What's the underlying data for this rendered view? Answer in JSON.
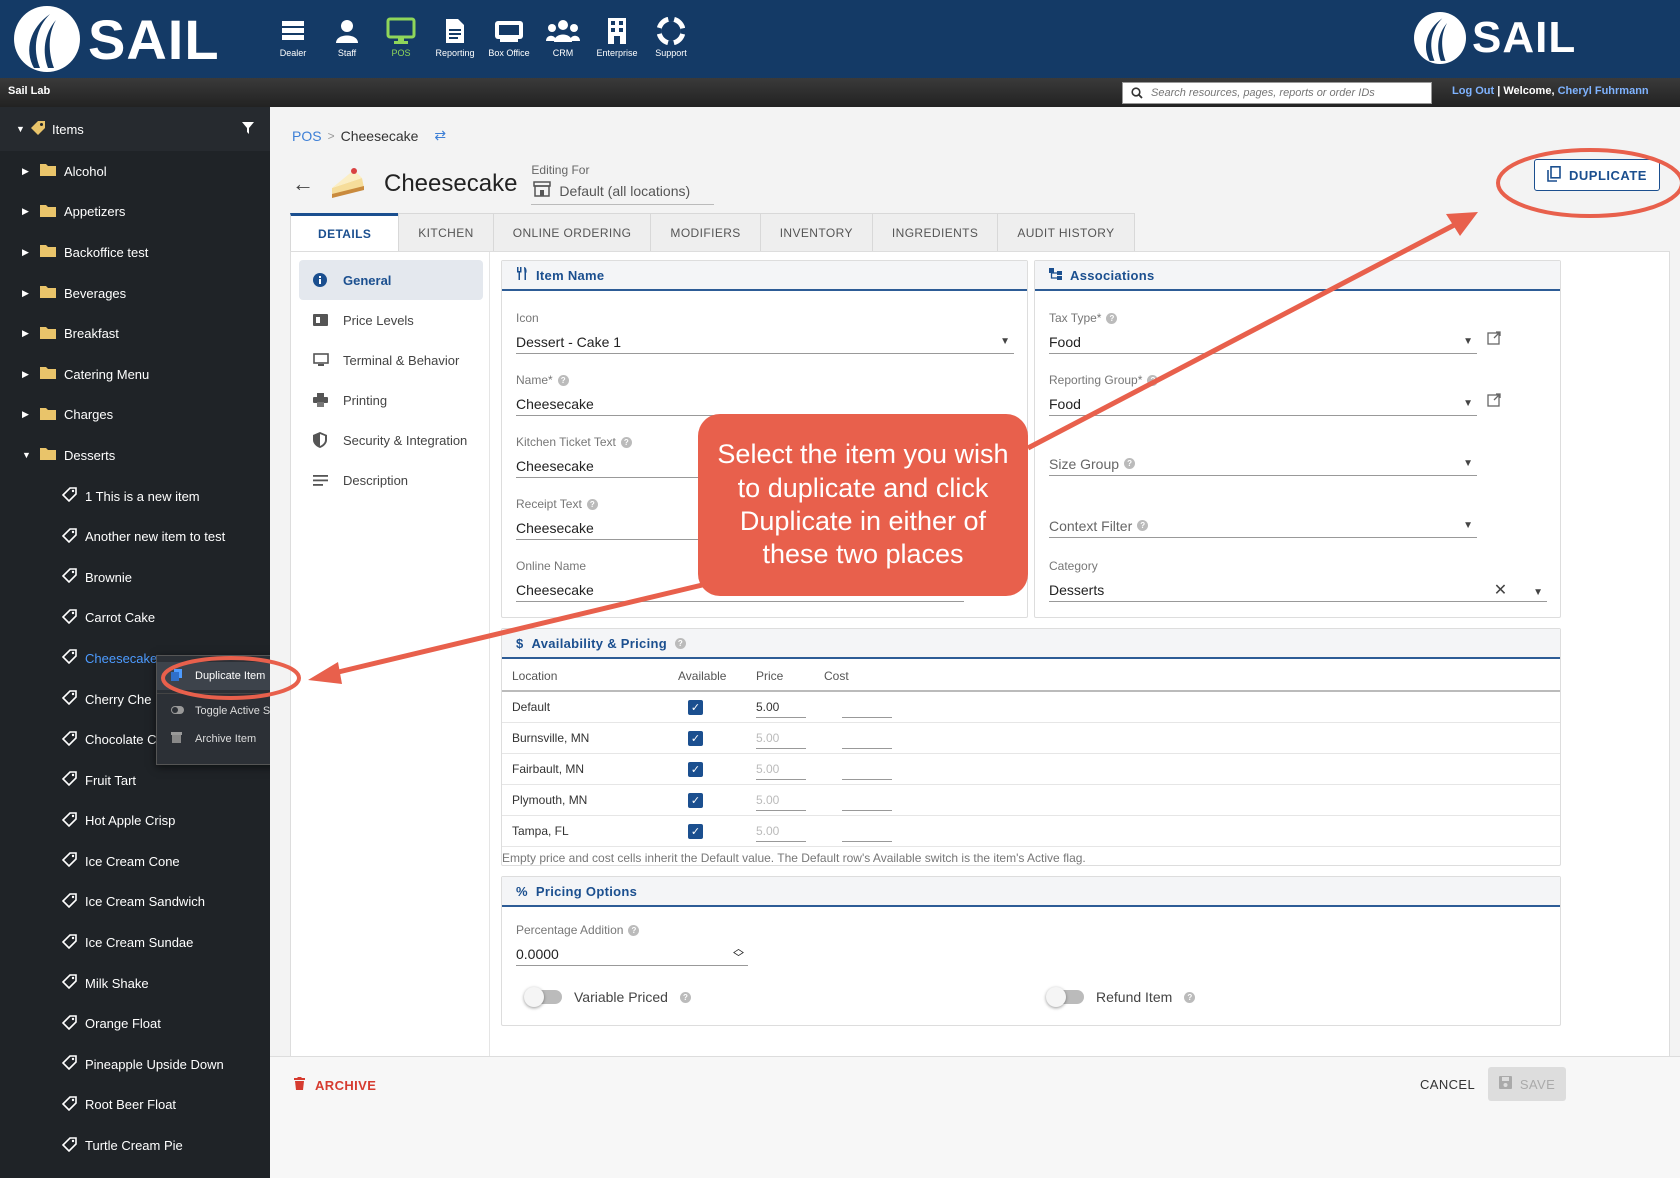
{
  "header": {
    "brand": "SAIL",
    "nav": [
      {
        "label": "Dealer",
        "icon": "dealer-icon"
      },
      {
        "label": "Staff",
        "icon": "staff-icon"
      },
      {
        "label": "POS",
        "icon": "pos-monitor-icon",
        "active": true
      },
      {
        "label": "Reporting",
        "icon": "reporting-icon"
      },
      {
        "label": "Box Office",
        "icon": "box-office-icon"
      },
      {
        "label": "CRM",
        "icon": "crm-icon"
      },
      {
        "label": "Enterprise",
        "icon": "enterprise-icon"
      },
      {
        "label": "Support",
        "icon": "support-icon"
      }
    ]
  },
  "subbar": {
    "org": "Sail Lab",
    "search_placeholder": "Search resources, pages, reports or order IDs",
    "logout": "Log Out",
    "welcome": "Welcome,",
    "user": "Cheryl Fuhrmann"
  },
  "sidebar": {
    "title": "Items",
    "folders_top": [
      "Alcohol",
      "Appetizers",
      "Backoffice test",
      "Beverages",
      "Breakfast",
      "Catering Menu",
      "Charges"
    ],
    "open_folder": "Desserts",
    "items": [
      "1 This is a new item",
      "Another new item to test",
      "Brownie",
      "Carrot Cake",
      "Cheesecake",
      "Cherry Cheesecake",
      "Chocolate Cake",
      "Fruit Tart",
      "Hot Apple Crisp",
      "Ice Cream Cone",
      "Ice Cream Sandwich",
      "Ice Cream Sundae",
      "Milk Shake",
      "Orange Float",
      "Pineapple Upside Down",
      "Root Beer Float",
      "Turtle Cream Pie"
    ],
    "items_visible": [
      "1 This is a new item",
      "Another new item to test",
      "Brownie",
      "Carrot Cake",
      "Cheesecake",
      "Cherry Che",
      "Chocolate C",
      "Fruit Tart",
      "Hot Apple Crisp",
      "Ice Cream Cone",
      "Ice Cream Sandwich",
      "Ice Cream Sundae",
      "Milk Shake",
      "Orange Float",
      "Pineapple Upside Down",
      "Root Beer Float",
      "Turtle Cream Pie"
    ],
    "selected_item": "Cheesecake"
  },
  "context_menu": {
    "items": [
      "Duplicate Item",
      "Toggle Active State",
      "Archive Item"
    ]
  },
  "breadcrumb": {
    "root": "POS",
    "sep": ">",
    "current": "Cheesecake"
  },
  "page": {
    "title": "Cheesecake",
    "editing_for_label": "Editing For",
    "editing_for_value": "Default (all locations)",
    "duplicate_label": "DUPLICATE"
  },
  "tabs": [
    "DETAILS",
    "KITCHEN",
    "ONLINE ORDERING",
    "MODIFIERS",
    "INVENTORY",
    "INGREDIENTS",
    "AUDIT HISTORY"
  ],
  "subnav": [
    "General",
    "Price Levels",
    "Terminal & Behavior",
    "Printing",
    "Security & Integration",
    "Description"
  ],
  "item_name": {
    "title": "Item Name",
    "icon_label": "Icon",
    "icon_value": "Dessert - Cake 1",
    "name_label": "Name*",
    "name_value": "Cheesecake",
    "kitchen_label": "Kitchen Ticket Text",
    "kitchen_value": "Cheesecake",
    "receipt_label": "Receipt Text",
    "receipt_value": "Cheesecake",
    "online_label": "Online Name",
    "online_value": "Cheesecake"
  },
  "associations": {
    "title": "Associations",
    "tax_label": "Tax Type*",
    "tax_value": "Food",
    "reporting_label": "Reporting Group*",
    "reporting_value": "Food",
    "size_label": "Size Group",
    "context_label": "Context Filter",
    "category_label": "Category",
    "category_value": "Desserts"
  },
  "availability": {
    "title": "Availability & Pricing",
    "columns": [
      "Location",
      "Available",
      "Price",
      "Cost"
    ],
    "rows": [
      {
        "location": "Default",
        "available": true,
        "price": "5.00",
        "cost": ""
      },
      {
        "location": "Burnsville, MN",
        "available": true,
        "price": "5.00",
        "cost": ""
      },
      {
        "location": "Fairbault, MN",
        "available": true,
        "price": "5.00",
        "cost": ""
      },
      {
        "location": "Plymouth, MN",
        "available": true,
        "price": "5.00",
        "cost": ""
      },
      {
        "location": "Tampa, FL",
        "available": true,
        "price": "5.00",
        "cost": ""
      }
    ],
    "note": "Empty price and cost cells inherit the Default value. The Default row's Available switch is the item's Active flag."
  },
  "pricing_options": {
    "title": "Pricing Options",
    "pct_label": "Percentage Addition",
    "pct_value": "0.0000",
    "variable_label": "Variable Priced",
    "refund_label": "Refund Item"
  },
  "footer": {
    "archive": "ARCHIVE",
    "cancel": "CANCEL",
    "save": "SAVE"
  },
  "callout": {
    "text": "Select the item you wish to duplicate and click Duplicate in either of these two places"
  },
  "colors": {
    "header": "#143a66",
    "accent": "#1b4f8f",
    "annotation": "#e8604c",
    "pos_active": "#8fd65a",
    "archive": "#d63b2f"
  }
}
